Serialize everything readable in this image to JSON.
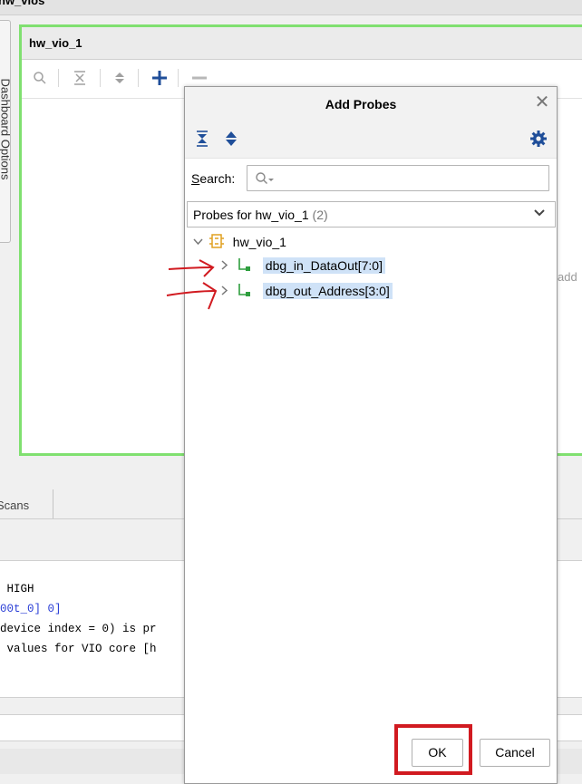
{
  "window_title": "hw_vios",
  "dashboard_tab_label": "Dashboard Options",
  "vio_panel": {
    "title": "hw_vio_1",
    "hint_text": "add"
  },
  "bottom_tabs": {
    "scans_label": "Scans"
  },
  "console_lines": [
    {
      "text": " HIGH",
      "color": "#000000"
    },
    {
      "text": "00t_0] 0]",
      "color": "#2a3ed6"
    },
    {
      "text": "device index = 0) is pr",
      "color": "#000000"
    },
    {
      "text": " values for VIO core [h",
      "color": "#000000"
    }
  ],
  "dialog": {
    "title": "Add Probes",
    "search_label": "Search:",
    "search_mnemonic": "S",
    "search_rest": "earch:",
    "search_value": "",
    "probes_for": "Probes for hw_vio_1",
    "probes_count": "(2)",
    "tree": {
      "root": "hw_vio_1",
      "children": [
        "dbg_in_DataOut[7:0]",
        "dbg_out_Address[3:0]"
      ]
    },
    "ok_label": "OK",
    "cancel_label": "Cancel"
  },
  "colors": {
    "frame_green": "#80e070",
    "selection": "#cfe2f7",
    "annotation_red": "#d11a20",
    "accent_blue": "#1f4e99"
  }
}
